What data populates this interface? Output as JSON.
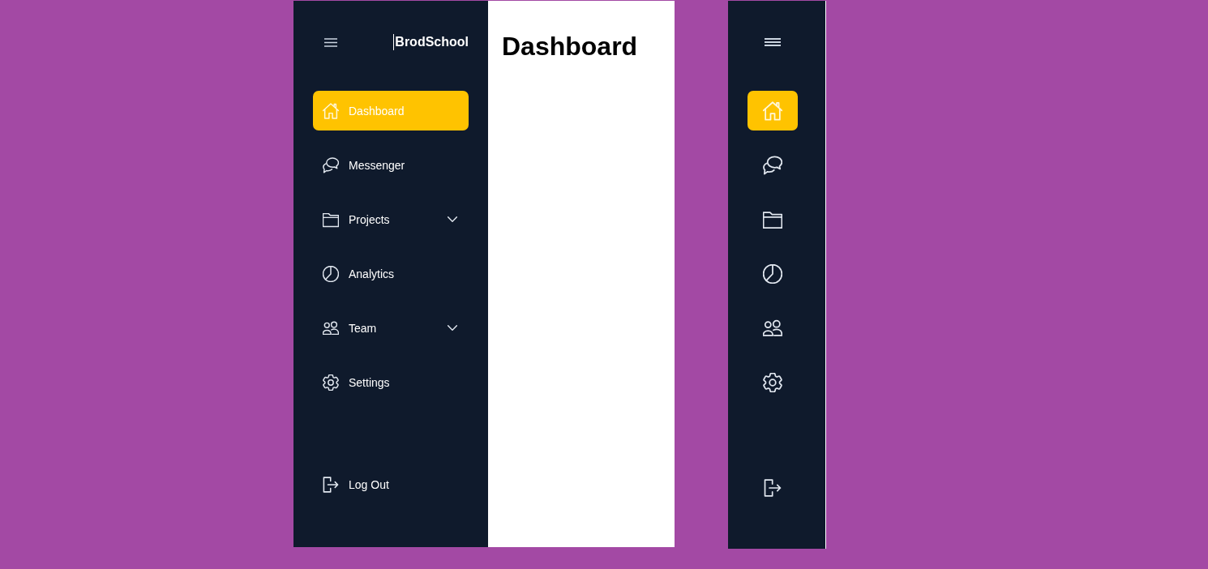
{
  "sidebar": {
    "logo": "BrodSchool",
    "items": [
      {
        "label": "Dashboard",
        "selected": true
      },
      {
        "label": "Messenger",
        "selected": false
      },
      {
        "label": "Projects",
        "selected": false,
        "expanded": false
      },
      {
        "label": "Analytics",
        "selected": false
      },
      {
        "label": "Team",
        "selected": false,
        "expanded": false
      },
      {
        "label": "Settings",
        "selected": false
      }
    ],
    "logout": {
      "label": "Log Out"
    }
  },
  "main": {
    "title": "Dashboard"
  },
  "collapsed_sidebar": {
    "items": [
      {
        "selected": true
      },
      {
        "selected": false
      },
      {
        "selected": false
      },
      {
        "selected": false
      },
      {
        "selected": false
      },
      {
        "selected": false
      }
    ]
  }
}
